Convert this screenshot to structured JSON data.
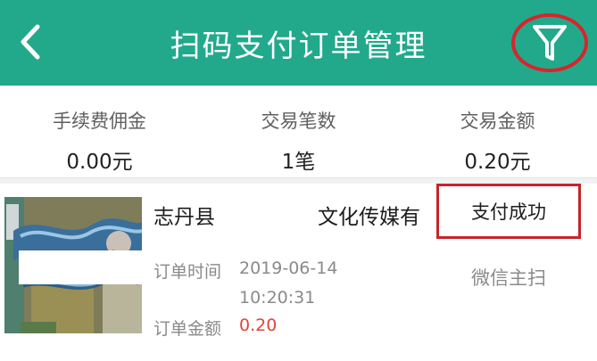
{
  "header": {
    "title": "扫码支付订单管理",
    "back_icon": "chevron-left-icon",
    "filter_icon": "filter-funnel-icon",
    "background_color": "#22a98c",
    "highlight_color": "#d9242b"
  },
  "stats": [
    {
      "label": "手续费佣金",
      "value": "0.00元"
    },
    {
      "label": "交易笔数",
      "value": "1笔"
    },
    {
      "label": "交易金额",
      "value": "0.20元"
    }
  ],
  "order": {
    "merchant_name_part1": "志丹县",
    "merchant_name_part2": "文化传媒有",
    "status": "支付成功",
    "order_time_label": "订单时间",
    "order_date": "2019-06-14",
    "order_clock": "10:20:31",
    "amount_label": "订单金额",
    "amount_value": "0.20",
    "amount_color": "#e0453a",
    "pay_method": "微信主扫"
  }
}
